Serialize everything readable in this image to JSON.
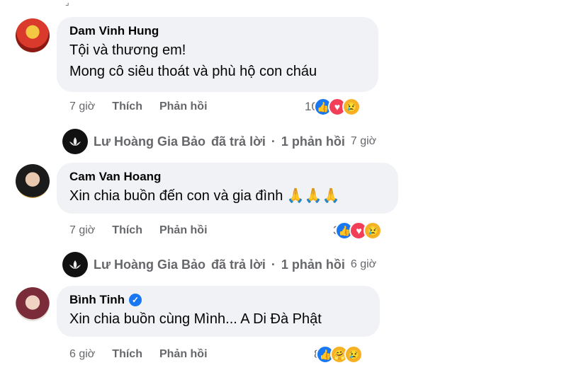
{
  "comments": [
    {
      "author": "Dam Vinh Hung",
      "lines": [
        "Tội và thương em!",
        "Mong cô siêu thoát và phù hộ con cháu"
      ],
      "time": "7 giờ",
      "like_label": "Thích",
      "reply_label": "Phản hồi",
      "reaction_count": "10",
      "reactions": [
        "like-icon",
        "love-icon",
        "sad-icon"
      ],
      "reply_summary": {
        "name": "Lư Hoàng Gia Bảo",
        "action": "đã trả lời",
        "separator": "·",
        "count": "1 phản hồi",
        "time": "7 giờ"
      }
    },
    {
      "author": "Cam Van Hoang",
      "lines": [
        "Xin chia buồn đến con và gia đình 🙏🙏🙏"
      ],
      "time": "7 giờ",
      "like_label": "Thích",
      "reply_label": "Phản hồi",
      "reaction_count": "3",
      "reactions": [
        "like-icon",
        "love-icon",
        "sad-icon"
      ],
      "reply_summary": {
        "name": "Lư Hoàng Gia Bảo",
        "action": "đã trả lời",
        "separator": "·",
        "count": "1 phản hồi",
        "time": "6 giờ"
      }
    },
    {
      "author": "Bình Tinh",
      "verified": true,
      "lines": [
        "Xin chia buồn cùng Mình... A Di Đà Phật"
      ],
      "time": "6 giờ",
      "like_label": "Thích",
      "reply_label": "Phản hồi",
      "reaction_count": "8",
      "reactions": [
        "like-icon",
        "care-icon",
        "sad-icon"
      ]
    }
  ],
  "colors": {
    "bubble": "#f0f2f5",
    "secondary_text": "#65676b",
    "like": "#1877f2",
    "love": "#f33e58",
    "sad": "#f7b125"
  }
}
